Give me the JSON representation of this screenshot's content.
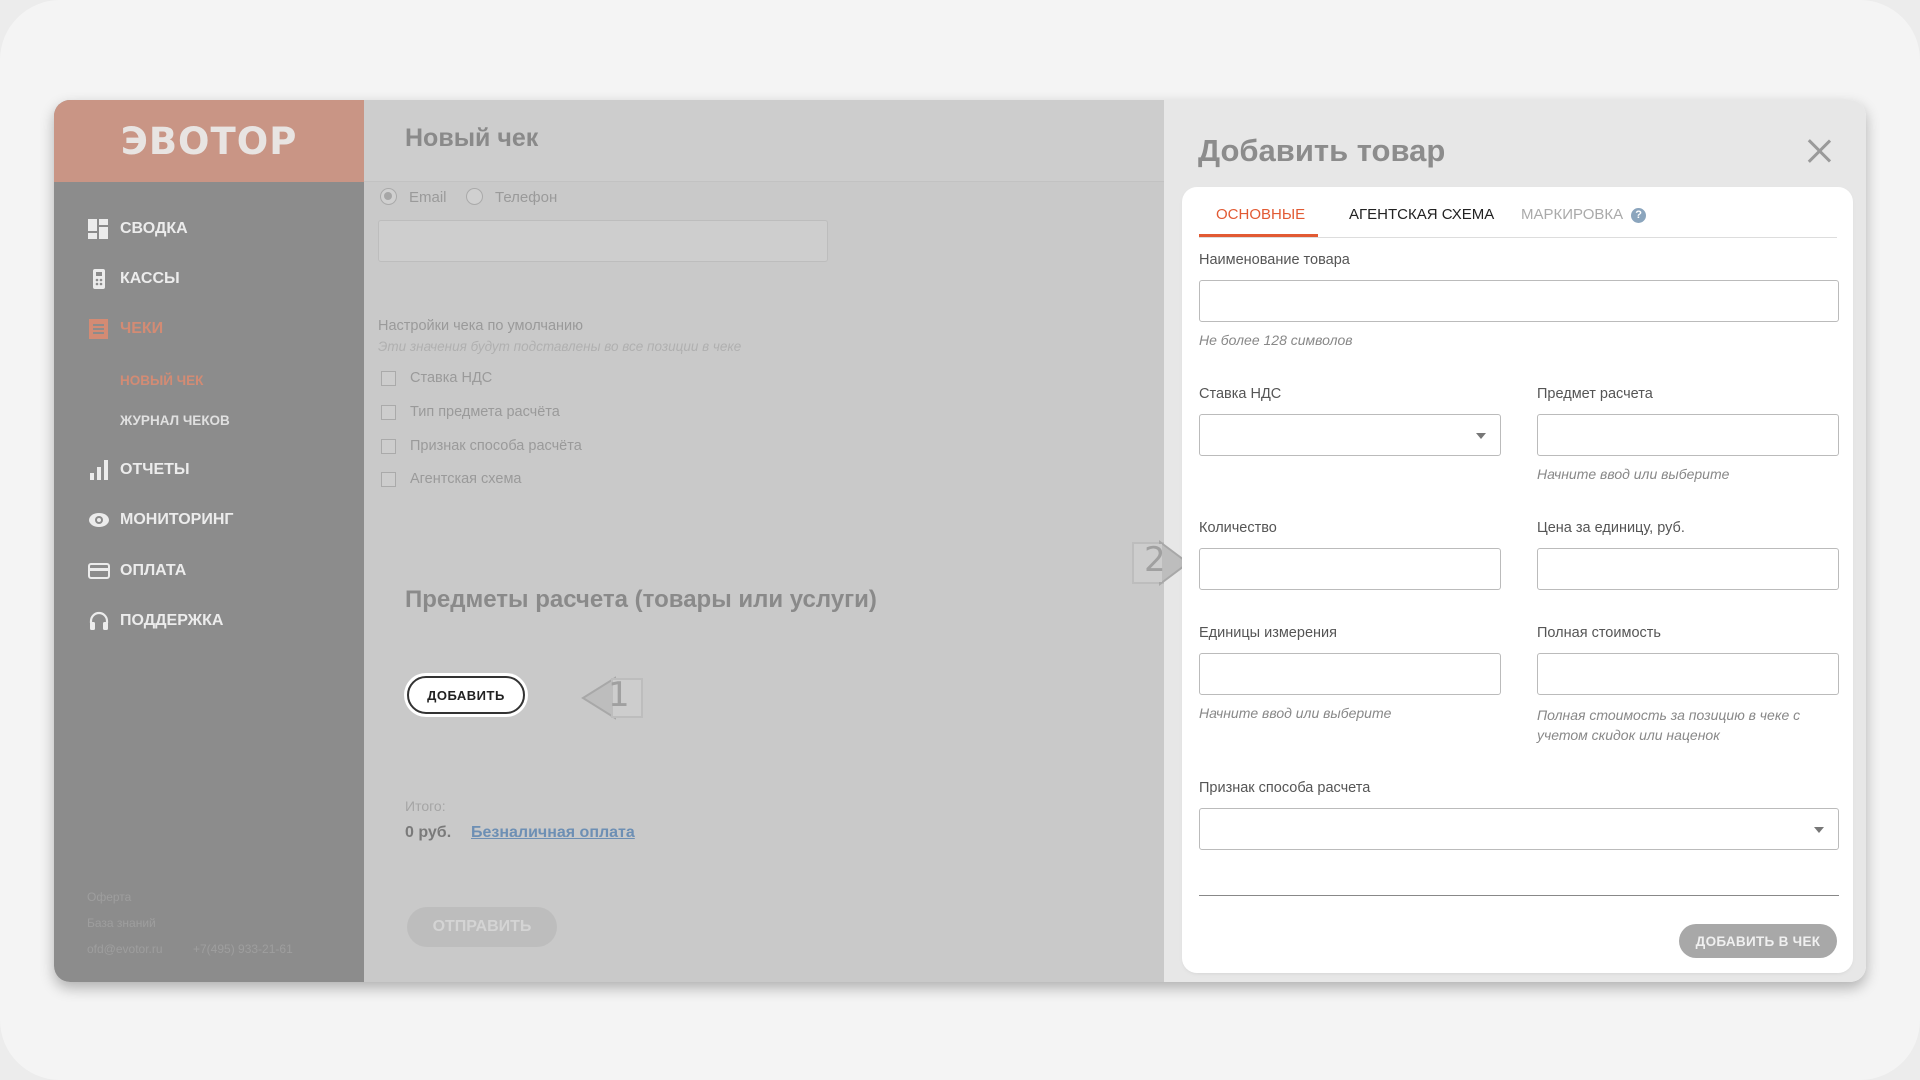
{
  "sidebar": {
    "logo": "ЭВОТОР",
    "items": [
      {
        "label": "СВОДКА",
        "icon": "dashboard-icon"
      },
      {
        "label": "КАССЫ",
        "icon": "cash-register-icon"
      },
      {
        "label": "ЧЕКИ",
        "icon": "receipt-icon",
        "active": true
      },
      {
        "label": "ОТЧЕТЫ",
        "icon": "bar-chart-icon"
      },
      {
        "label": "МОНИТОРИНГ",
        "icon": "eye-icon"
      },
      {
        "label": "ОПЛАТА",
        "icon": "credit-card-icon"
      },
      {
        "label": "ПОДДЕРЖКА",
        "icon": "headset-icon"
      }
    ],
    "subitems": [
      {
        "label": "НОВЫЙ ЧЕК",
        "active": true
      },
      {
        "label": "ЖУРНАЛ ЧЕКОВ"
      }
    ],
    "footer": {
      "offer": "Оферта",
      "kb": "База знаний",
      "email": "ofd@evotor.ru",
      "phone": "+7(495) 933-21-61"
    }
  },
  "main": {
    "title": "Новый чек",
    "contact": {
      "email": "Email",
      "phone": "Телефон"
    },
    "defaults": {
      "title": "Настройки чека по умолчанию",
      "subtitle": "Эти значения будут подставлены во все позиции в чеке",
      "options": [
        "Ставка НДС",
        "Тип предмета расчёта",
        "Признак способа расчёта",
        "Агентская схема"
      ]
    },
    "items_heading": "Предметы расчета (товары или услуги)",
    "add_button": "ДОБАВИТЬ",
    "total_label": "Итого:",
    "total_value": "0 руб.",
    "payment_link": "Безналичная оплата",
    "send_button": "ОТПРАВИТЬ"
  },
  "panel": {
    "title": "Добавить товар",
    "tabs": [
      {
        "label": "ОСНОВНЫЕ",
        "active": true
      },
      {
        "label": "АГЕНТСКАЯ СХЕМА"
      },
      {
        "label": "МАРКИРОВКА",
        "disabled": true
      }
    ],
    "fields": {
      "name_label": "Наименование товара",
      "name_hint": "Не более 128 символов",
      "vat_label": "Ставка НДС",
      "subject_label": "Предмет расчета",
      "subject_hint": "Начните ввод или выберите",
      "qty_label": "Количество",
      "price_label": "Цена за единицу, руб.",
      "unit_label": "Единицы измерения",
      "unit_hint": "Начните ввод или выберите",
      "total_label": "Полная стоимость",
      "total_hint": "Полная стоимость за позицию в чеке с учетом скидок или наценок",
      "method_label": "Признак способа расчета"
    },
    "submit_button": "ДОБАВИТЬ В ЧЕК"
  },
  "callouts": {
    "one": "1",
    "two": "2"
  }
}
